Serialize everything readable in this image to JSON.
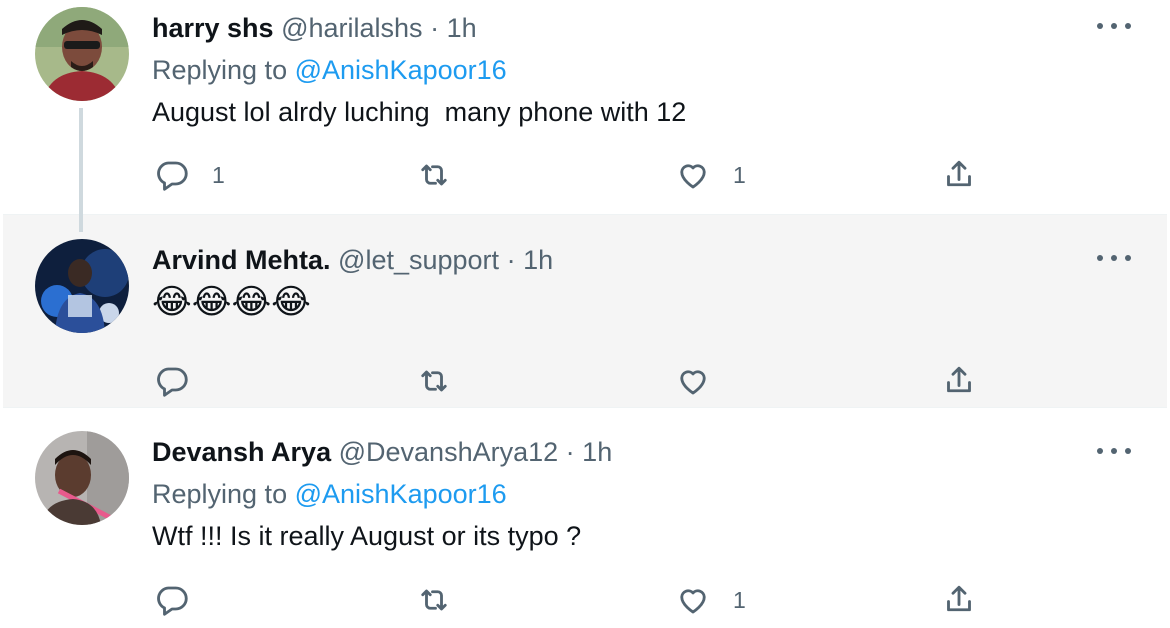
{
  "tweets": [
    {
      "display_name": "harry shs",
      "handle": "@harilalshs",
      "separator": "·",
      "time": "1h",
      "replying_label": "Replying to",
      "replying_to": "@AnishKapoor16",
      "text": "August lol alrdy luching  many phone with 12",
      "reply_count": "1",
      "retweet_count": "",
      "like_count": "1",
      "highlighted": false,
      "avatar_colors": [
        "#a7b98a",
        "#7c4b3c",
        "#9c2b33"
      ]
    },
    {
      "display_name": "Arvind Mehta.",
      "handle": "@let_support",
      "separator": "·",
      "time": "1h",
      "text": "😂😂😂😂",
      "reply_count": "",
      "retweet_count": "",
      "like_count": "",
      "highlighted": true,
      "avatar_colors": [
        "#0e1f3d",
        "#2b6fd1",
        "#c9d6ea"
      ]
    },
    {
      "display_name": "Devansh Arya",
      "handle": "@DevanshArya12",
      "separator": "·",
      "time": "1h",
      "replying_label": "Replying to",
      "replying_to": "@AnishKapoor16",
      "text": "Wtf !!! Is it really August or its typo ?",
      "reply_count": "",
      "retweet_count": "",
      "like_count": "1",
      "highlighted": false,
      "avatar_colors": [
        "#b7b4b2",
        "#5b3c2f",
        "#e85a8c"
      ]
    }
  ],
  "icons": {
    "reply": "reply-icon",
    "retweet": "retweet-icon",
    "like": "heart-icon",
    "share": "share-icon",
    "more": "more-icon"
  },
  "colors": {
    "link": "#1d9bf0",
    "secondary_text": "#536471",
    "highlight_bg": "#f5f5f5",
    "thread_line": "#cfd9de"
  }
}
